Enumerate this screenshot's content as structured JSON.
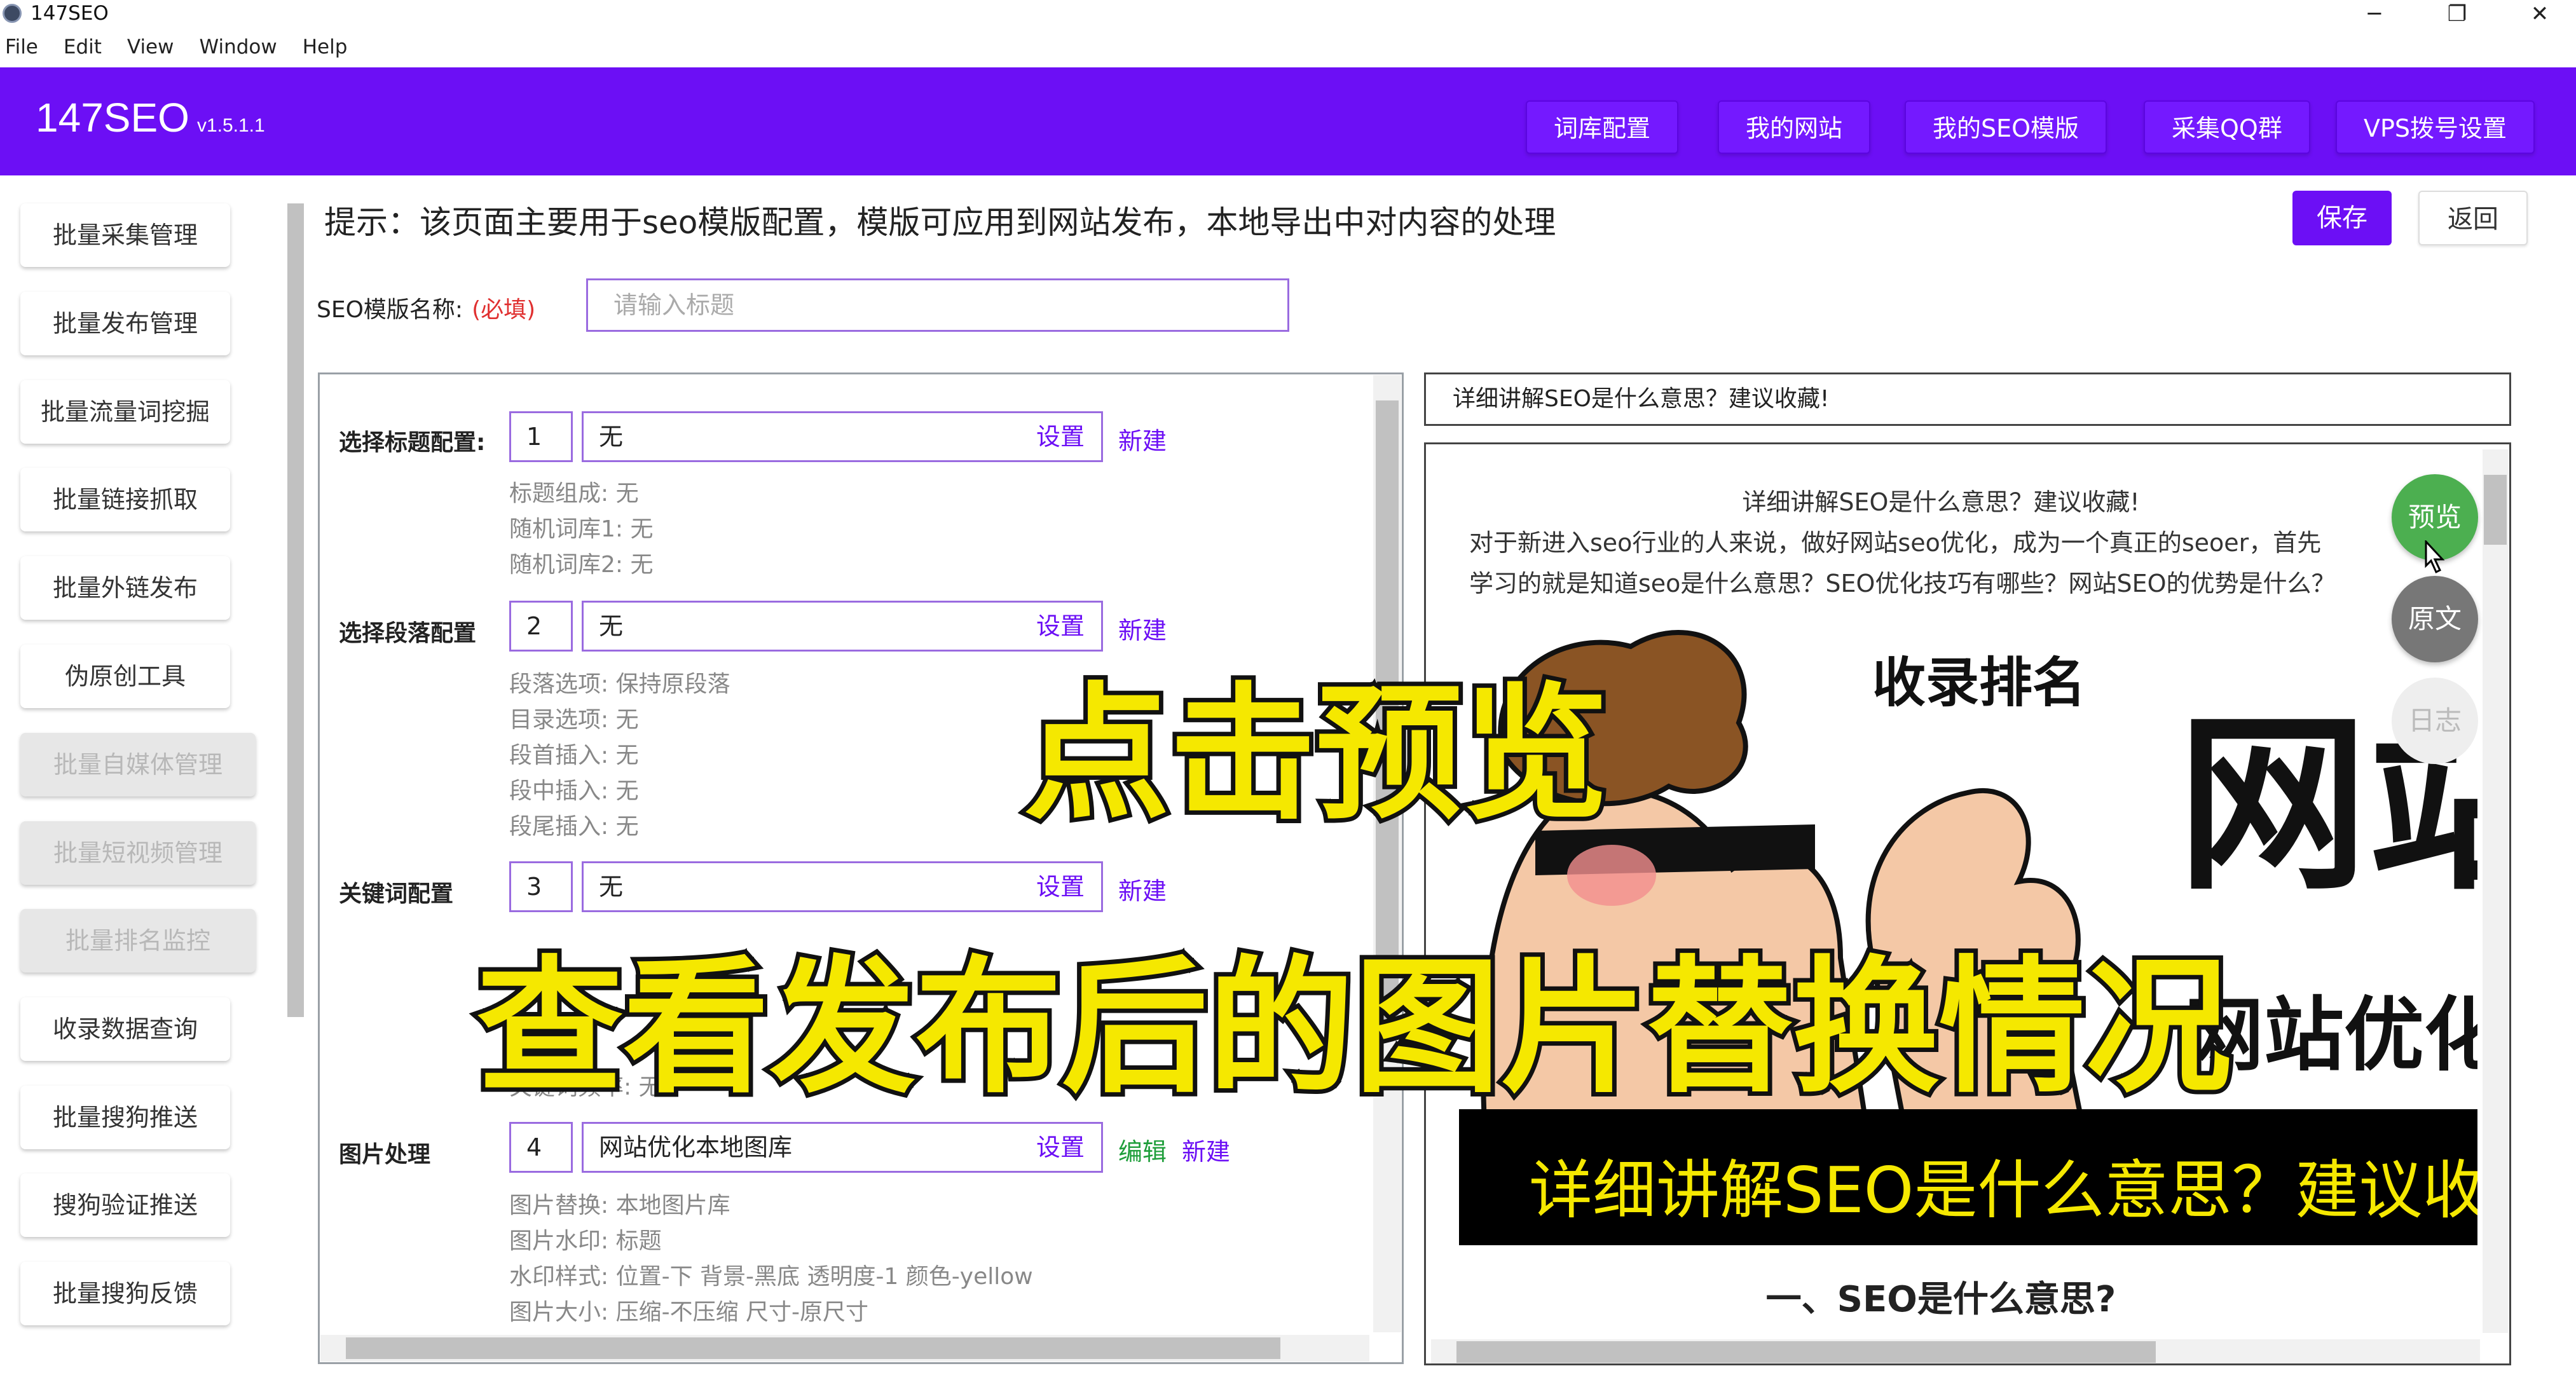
{
  "app": {
    "title": "147SEO",
    "brand": "147SEO",
    "version": "v1.5.1.1"
  },
  "window_controls": {
    "minimize": "─",
    "maximize": "❐",
    "close": "✕"
  },
  "menu": [
    "File",
    "Edit",
    "View",
    "Window",
    "Help"
  ],
  "top_nav": [
    "词库配置",
    "我的网站",
    "我的SEO模版",
    "采集QQ群",
    "VPS拨号设置"
  ],
  "sidebar": [
    {
      "label": "批量采集管理",
      "disabled": false
    },
    {
      "label": "批量发布管理",
      "disabled": false
    },
    {
      "label": "批量流量词挖掘",
      "disabled": false
    },
    {
      "label": "批量链接抓取",
      "disabled": false
    },
    {
      "label": "批量外链发布",
      "disabled": false
    },
    {
      "label": "伪原创工具",
      "disabled": false
    },
    {
      "label": "批量自媒体管理",
      "disabled": true
    },
    {
      "label": "批量短视频管理",
      "disabled": true
    },
    {
      "label": "批量排名监控",
      "disabled": true
    },
    {
      "label": "收录数据查询",
      "disabled": false
    },
    {
      "label": "批量搜狗推送",
      "disabled": false
    },
    {
      "label": "搜狗验证推送",
      "disabled": false
    },
    {
      "label": "批量搜狗反馈",
      "disabled": false
    }
  ],
  "tip": "提示：该页面主要用于seo模版配置，模版可应用到网站发布，本地导出中对内容的处理",
  "actions": {
    "save": "保存",
    "back": "返回"
  },
  "template_name": {
    "label": "SEO模版名称:",
    "required": "(必填)",
    "placeholder": "请输入标题"
  },
  "config": {
    "title": {
      "label": "选择标题配置:",
      "num": "1",
      "value": "无",
      "set": "设置",
      "new": "新建",
      "details": [
        "标题组成: 无",
        "随机词库1: 无",
        "随机词库2: 无"
      ]
    },
    "paragraph": {
      "label": "选择段落配置",
      "num": "2",
      "value": "无",
      "set": "设置",
      "new": "新建",
      "details": [
        "段落选项: 保持原段落",
        "目录选项: 无",
        "段首插入: 无",
        "段中插入: 无",
        "段尾插入: 无"
      ]
    },
    "keyword": {
      "label": "关键词配置",
      "num": "3",
      "value": "无",
      "set": "设置",
      "new": "新建",
      "details": [
        "关键词频率: 无"
      ]
    },
    "image": {
      "label": "图片处理",
      "num": "4",
      "value": "网站优化本地图库",
      "set": "设置",
      "edit": "编辑",
      "new": "新建",
      "details": [
        "图片替换: 本地图片库",
        "图片水印: 标题",
        "水印样式: 位置-下 背景-黑底 透明度-1 颜色-yellow",
        "图片大小: 压缩-不压缩 尺寸-原尺寸"
      ]
    }
  },
  "preview": {
    "header_title": "详细讲解SEO是什么意思？建议收藏!",
    "article_title": "详细讲解SEO是什么意思？建议收藏!",
    "para1": "对于新进入seo行业的人来说，做好网站seo优化，成为一个真正的seoer，首先",
    "para2": "学习的就是知道seo是什么意思？SEO优化技巧有哪些？网站SEO的优势是什么？",
    "image_text_rank": "收录排名",
    "image_text_big": "网站",
    "image_text_mid": "网站优化",
    "watermark": "详细讲解SEO是什么意思？建议收藏",
    "heading": "一、SEO是什么意思?",
    "buttons": {
      "preview": "预览",
      "original": "原文",
      "log": "日志"
    }
  },
  "overlay": {
    "line1": "点击预览",
    "line2": "查看发布后的图片替换情况"
  },
  "colors": {
    "brand": "#6c0ff5",
    "link_green": "#1e9e3a",
    "required_red": "#e03030",
    "preview_green": "#4caf50",
    "caption_yellow": "#f5e800"
  }
}
